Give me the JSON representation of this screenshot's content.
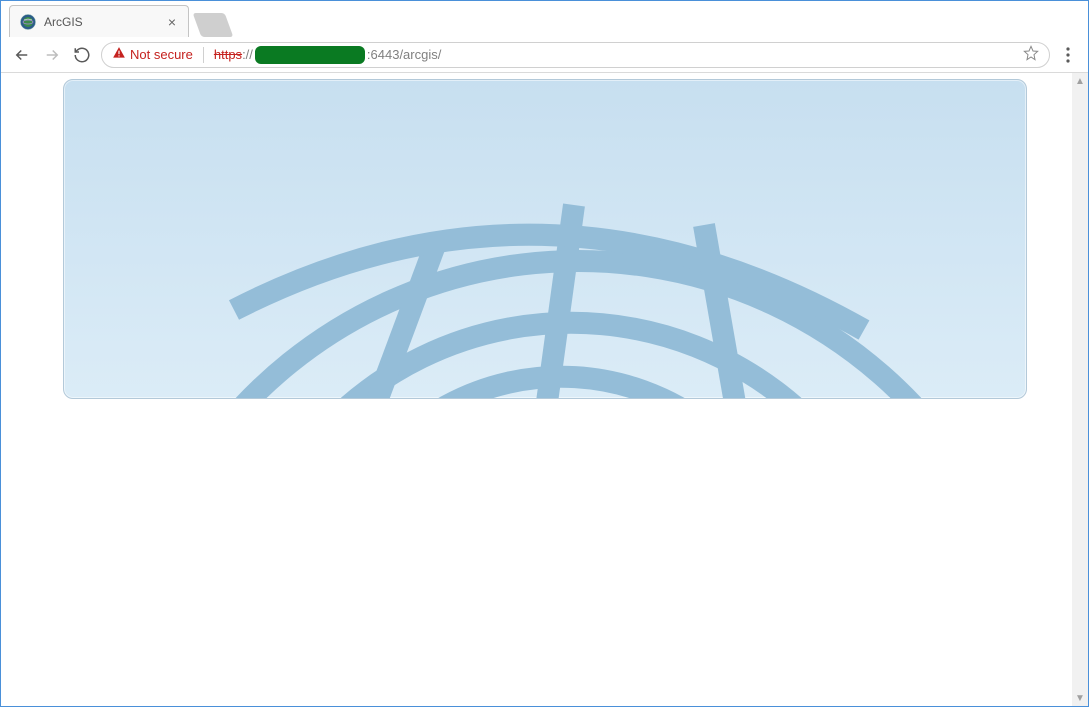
{
  "window": {
    "tab_title": "ArcGIS",
    "security_text": "Not secure",
    "url_prefix_https": "https",
    "url_prefix_slashes": "://",
    "url_suffix": ":6443/arcgis/"
  },
  "icons": {
    "user": "user-icon",
    "minimize": "minimize-icon",
    "maximize": "maximize-icon",
    "close": "close-icon",
    "back": "back-icon",
    "forward": "forward-icon",
    "reload": "reload-icon",
    "warning": "warning-icon",
    "star": "star-icon",
    "menu": "menu-icon"
  }
}
